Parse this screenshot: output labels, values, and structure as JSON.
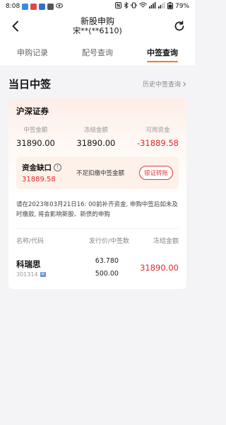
{
  "status_bar": {
    "time": "8:08",
    "battery": "79%"
  },
  "header": {
    "title": "新股申购",
    "account": "宋**(**6110)",
    "back_icon": "chevron-left-icon",
    "refresh_icon": "refresh-icon"
  },
  "tabs": [
    {
      "label": "申购记录",
      "active": false
    },
    {
      "label": "配号查询",
      "active": false
    },
    {
      "label": "中签查询",
      "active": true
    }
  ],
  "section": {
    "title": "当日中签",
    "history_link": "历史中签查询"
  },
  "card": {
    "market": "沪深证券",
    "stats": [
      {
        "label": "中签金额",
        "value": "31890.00"
      },
      {
        "label": "冻结金额",
        "value": "31890.00"
      },
      {
        "label": "可用资金",
        "value": "-31889.58"
      }
    ],
    "gap": {
      "title": "资金缺口",
      "value": "31889.58",
      "note": "不足扣缴中签金额",
      "button": "银证转账"
    },
    "notice": "请在2023年03月21日16: 00前补齐资金, 申购中签后如未及时缴款, 将会影响新股、新债的申购",
    "table": {
      "headers": [
        "名称/代码",
        "发行价/中签数",
        "冻结金额"
      ],
      "rows": [
        {
          "name": "科瑞思",
          "code": "301314",
          "badge": "深",
          "price": "63.780",
          "count": "500.00",
          "frozen": "31890.00"
        }
      ]
    }
  },
  "colors": {
    "accent": "#f2792b",
    "negative": "#e02a2a",
    "background": "#f4f4f6"
  }
}
